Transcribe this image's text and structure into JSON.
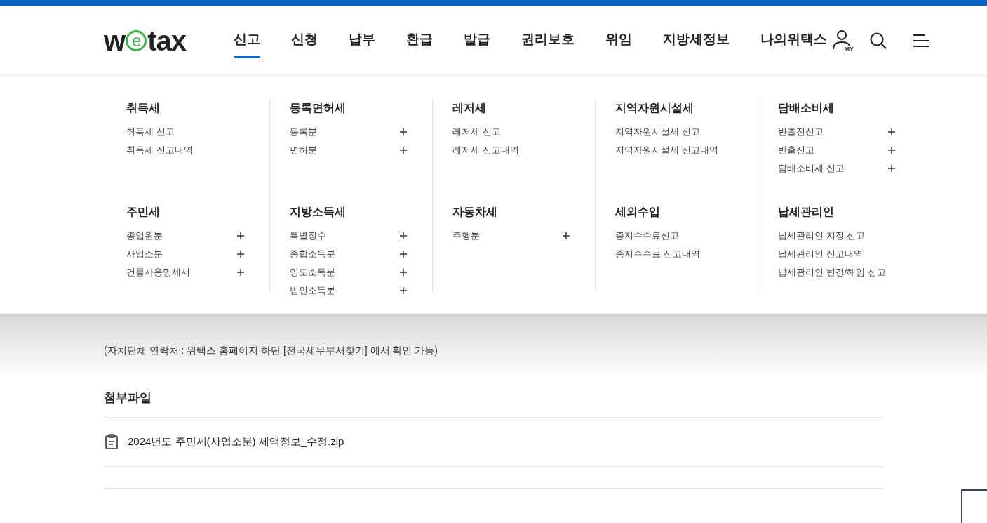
{
  "header": {
    "logo": {
      "pre": "w",
      "mid": "e",
      "post": "tax"
    },
    "nav": [
      {
        "label": "신고",
        "selected": true
      },
      {
        "label": "신청",
        "selected": false
      },
      {
        "label": "납부",
        "selected": false
      },
      {
        "label": "환급",
        "selected": false
      },
      {
        "label": "발급",
        "selected": false
      },
      {
        "label": "권리보호",
        "selected": false
      },
      {
        "label": "위임",
        "selected": false
      },
      {
        "label": "지방세정보",
        "selected": false
      },
      {
        "label": "나의위택스",
        "selected": false
      }
    ],
    "my_label": "MY"
  },
  "menu": {
    "groups": [
      {
        "title": "취득세",
        "items": [
          {
            "label": "취득세 신고",
            "expandable": false
          },
          {
            "label": "취득세 신고내역",
            "expandable": false
          }
        ]
      },
      {
        "title": "등록면허세",
        "items": [
          {
            "label": "등록분",
            "expandable": true
          },
          {
            "label": "면허분",
            "expandable": true
          }
        ]
      },
      {
        "title": "레저세",
        "items": [
          {
            "label": "레저세 신고",
            "expandable": false
          },
          {
            "label": "레저세 신고내역",
            "expandable": false
          }
        ]
      },
      {
        "title": "지역자원시설세",
        "items": [
          {
            "label": "지역자원시설세 신고",
            "expandable": false
          },
          {
            "label": "지역자원시설세 신고내역",
            "expandable": false
          }
        ]
      },
      {
        "title": "담배소비세",
        "items": [
          {
            "label": "반출전신고",
            "expandable": true
          },
          {
            "label": "반출신고",
            "expandable": true
          },
          {
            "label": "담배소비세 신고",
            "expandable": true
          }
        ]
      },
      {
        "title": "주민세",
        "items": [
          {
            "label": "종업원분",
            "expandable": true
          },
          {
            "label": "사업소분",
            "expandable": true
          },
          {
            "label": "건물사용명세서",
            "expandable": true
          }
        ]
      },
      {
        "title": "지방소득세",
        "items": [
          {
            "label": "특별징수",
            "expandable": true
          },
          {
            "label": "종합소득분",
            "expandable": true
          },
          {
            "label": "양도소득분",
            "expandable": true
          },
          {
            "label": "법인소득분",
            "expandable": true
          }
        ]
      },
      {
        "title": "자동차세",
        "items": [
          {
            "label": "주행분",
            "expandable": true
          }
        ]
      },
      {
        "title": "세외수입",
        "items": [
          {
            "label": "증지수수료신고",
            "expandable": false
          },
          {
            "label": "증지수수료 신고내역",
            "expandable": false
          }
        ]
      },
      {
        "title": "납세관리인",
        "items": [
          {
            "label": "납세관리인 지정 신고",
            "expandable": false
          },
          {
            "label": "납세관리인 신고내역",
            "expandable": false
          },
          {
            "label": "납세관리인 변경/해임 신고",
            "expandable": false
          }
        ]
      }
    ]
  },
  "content": {
    "note": "(자치단체 연락처 : 위택스 홈페이지 하단 [전국세무부서찾기] 에서 확인 가능)",
    "attachments_title": "첨부파일",
    "files": [
      "2024년도 주민세(사업소분) 세액정보_수정.zip"
    ]
  }
}
